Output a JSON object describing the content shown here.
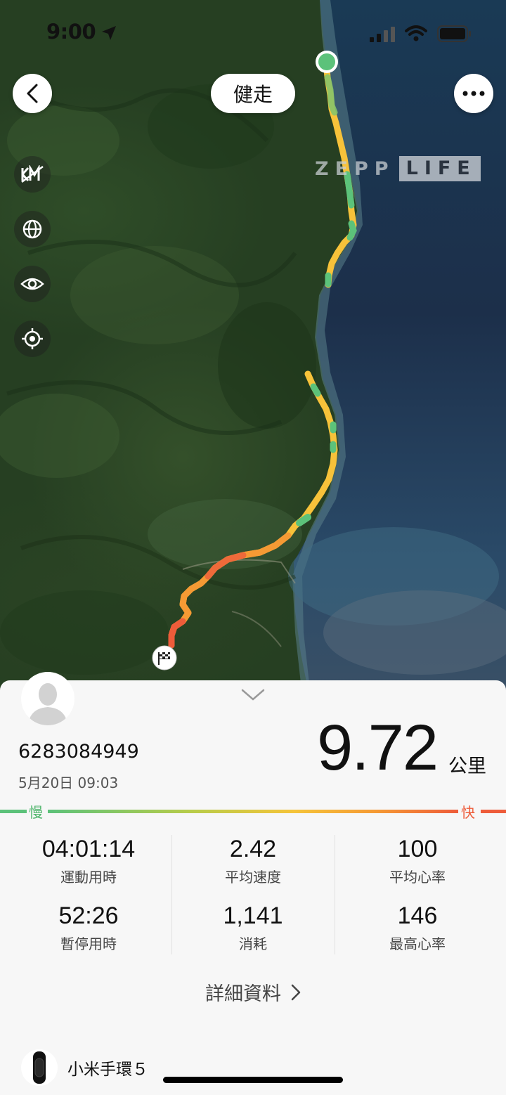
{
  "status_bar": {
    "time": "9:00"
  },
  "map": {
    "mode_label": "健走",
    "brand_left": "ZEPP",
    "brand_right": "LIFE",
    "tools": [
      "km-toggle-icon",
      "globe-icon",
      "eye-icon",
      "locate-icon"
    ],
    "colors": {
      "green": "#5cc27a",
      "yellow": "#f7c23a",
      "orange": "#f59a34",
      "red": "#ee5c3a",
      "sea": "#1c3350"
    }
  },
  "summary": {
    "user_id": "6283084949",
    "date": "5月20日 09:03",
    "distance": "9.72",
    "distance_unit": "公里",
    "speed_slow": "慢",
    "speed_fast": "快"
  },
  "stats": [
    {
      "value": "04:01:14",
      "label": "運動用時"
    },
    {
      "value": "52:26",
      "label": "暫停用時"
    },
    {
      "value": "2.42",
      "label": "平均速度"
    },
    {
      "value": "1,141",
      "label": "消耗"
    },
    {
      "value": "100",
      "label": "平均心率"
    },
    {
      "value": "146",
      "label": "最高心率"
    }
  ],
  "details_link": "詳細資料",
  "device": {
    "name": "小米手環５"
  }
}
